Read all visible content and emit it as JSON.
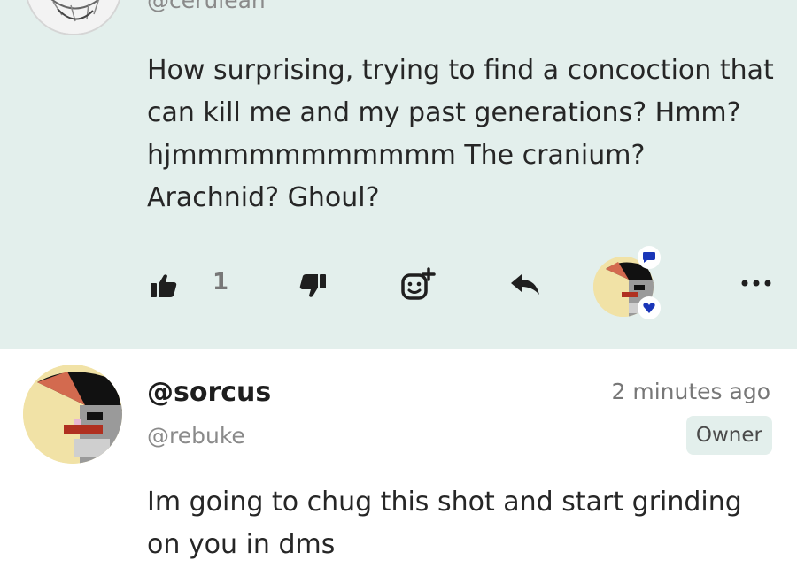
{
  "top_comment": {
    "handle": "@cerulean",
    "body": "How surprising, trying to find a concoction that can kill me and my past generations? Hmm? hjmmmmmmmmmmm The cranium? Arachnid? Ghoul?",
    "actions": {
      "like_icon": "thumbs-up-icon",
      "like_count": "1",
      "dislike_icon": "thumbs-down-icon",
      "react_icon": "add-reaction-icon",
      "reply_icon": "reply-icon",
      "more_icon": "more-icon"
    },
    "reactor": {
      "badge_top_icon": "chat-bubble-icon",
      "badge_bottom_icon": "heart-icon"
    }
  },
  "reply_comment": {
    "username": "@sorcus",
    "handle": "@rebuke",
    "timestamp": "2 minutes ago",
    "role_badge": "Owner",
    "body": "Im going to chug this shot and start grinding on you in dms"
  },
  "colors": {
    "highlight_background": "#e3efec",
    "badge_icon_blue": "#1a36b8",
    "icon_dark": "#1f1f1f"
  }
}
